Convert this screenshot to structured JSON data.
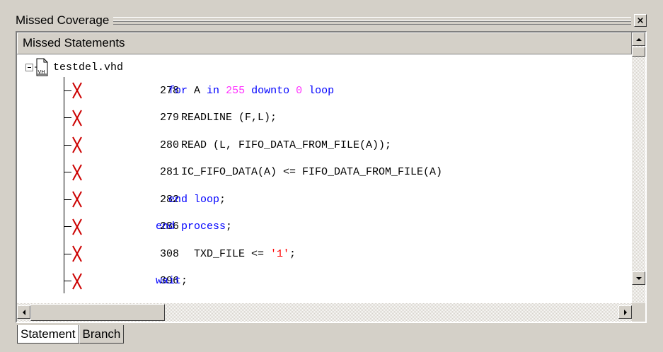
{
  "window": {
    "title": "Missed Coverage",
    "close_glyph": "×"
  },
  "panel": {
    "header": "Missed Statements"
  },
  "tree": {
    "root": {
      "label": "testdel.vhd",
      "icon": "vhd-file-icon",
      "icon_text": "VH"
    },
    "items": [
      {
        "line": "278",
        "indent": "  ",
        "tokens": [
          {
            "t": "kw",
            "v": "for"
          },
          {
            "t": "plain",
            "v": " A "
          },
          {
            "t": "kw",
            "v": "in"
          },
          {
            "t": "plain",
            "v": " "
          },
          {
            "t": "num",
            "v": "255"
          },
          {
            "t": "plain",
            "v": " "
          },
          {
            "t": "kw",
            "v": "downto"
          },
          {
            "t": "plain",
            "v": " "
          },
          {
            "t": "num",
            "v": "0"
          },
          {
            "t": "plain",
            "v": " "
          },
          {
            "t": "kw",
            "v": "loop"
          }
        ]
      },
      {
        "line": "279",
        "indent": "    ",
        "tokens": [
          {
            "t": "plain",
            "v": "READLINE (F,L);"
          }
        ]
      },
      {
        "line": "280",
        "indent": "    ",
        "tokens": [
          {
            "t": "plain",
            "v": "READ (L, FIFO_DATA_FROM_FILE(A));"
          }
        ]
      },
      {
        "line": "281",
        "indent": "    ",
        "tokens": [
          {
            "t": "plain",
            "v": "IC_FIFO_DATA(A) <= FIFO_DATA_FROM_FILE(A)"
          }
        ]
      },
      {
        "line": "282",
        "indent": "  ",
        "tokens": [
          {
            "t": "kw",
            "v": "end"
          },
          {
            "t": "plain",
            "v": " "
          },
          {
            "t": "kw",
            "v": "loop"
          },
          {
            "t": "plain",
            "v": ";"
          }
        ]
      },
      {
        "line": "286",
        "indent": "",
        "tokens": [
          {
            "t": "kw",
            "v": "end"
          },
          {
            "t": "plain",
            "v": " "
          },
          {
            "t": "kw",
            "v": "process"
          },
          {
            "t": "plain",
            "v": ";"
          }
        ]
      },
      {
        "line": "308",
        "indent": "      ",
        "tokens": [
          {
            "t": "plain",
            "v": "TXD_FILE <= "
          },
          {
            "t": "str",
            "v": "'1'"
          },
          {
            "t": "plain",
            "v": ";"
          }
        ]
      },
      {
        "line": "396",
        "indent": "",
        "tokens": [
          {
            "t": "kw",
            "v": "wait"
          },
          {
            "t": "plain",
            "v": ";"
          }
        ]
      }
    ],
    "missed_icon": "red-x-icon"
  },
  "tabs": [
    {
      "label": "Statement",
      "active": true
    },
    {
      "label": "Branch",
      "active": false
    }
  ],
  "colors": {
    "keyword": "#0000ff",
    "number": "#ff33ff",
    "string": "#ff0000",
    "missed_x": "#cc0000",
    "face": "#d4d0c8"
  }
}
